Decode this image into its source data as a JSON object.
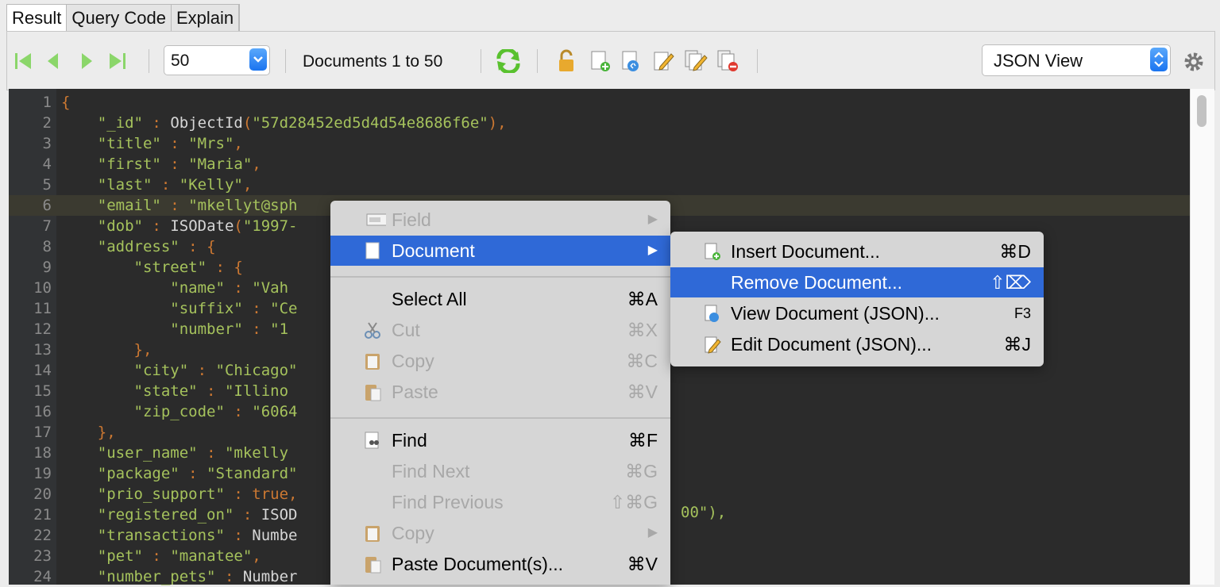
{
  "tabs": [
    "Result",
    "Query Code",
    "Explain"
  ],
  "toolbar": {
    "page_size": "50",
    "documents_text": "Documents 1 to 50",
    "view_mode": "JSON View"
  },
  "editor": {
    "lines": [
      {
        "n": "1",
        "t": "{"
      },
      {
        "n": "2",
        "t": "    \"_id\" : ObjectId(\"57d28452ed5d4d54e8686f6e\"),"
      },
      {
        "n": "3",
        "t": "    \"title\" : \"Mrs\","
      },
      {
        "n": "4",
        "t": "    \"first\" : \"Maria\","
      },
      {
        "n": "5",
        "t": "    \"last\" : \"Kelly\","
      },
      {
        "n": "6",
        "t": "    \"email\" : \"mkellyt@sph"
      },
      {
        "n": "7",
        "t": "    \"dob\" : ISODate(\"1997-"
      },
      {
        "n": "8",
        "t": "    \"address\" : {"
      },
      {
        "n": "9",
        "t": "        \"street\" : {"
      },
      {
        "n": "10",
        "t": "            \"name\" : \"Vah"
      },
      {
        "n": "11",
        "t": "            \"suffix\" : \"Ce"
      },
      {
        "n": "12",
        "t": "            \"number\" : \"1"
      },
      {
        "n": "13",
        "t": "        },"
      },
      {
        "n": "14",
        "t": "        \"city\" : \"Chicago\""
      },
      {
        "n": "15",
        "t": "        \"state\" : \"Illino"
      },
      {
        "n": "16",
        "t": "        \"zip_code\" : \"6064"
      },
      {
        "n": "17",
        "t": "    },"
      },
      {
        "n": "18",
        "t": "    \"user_name\" : \"mkelly"
      },
      {
        "n": "19",
        "t": "    \"package\" : \"Standard\""
      },
      {
        "n": "20",
        "t": "    \"prio_support\" : true,"
      },
      {
        "n": "21",
        "t": "    \"registered_on\" : ISOD"
      },
      {
        "n": "22",
        "t": "    \"transactions\" : Numbe"
      },
      {
        "n": "23",
        "t": "    \"pet\" : \"manatee\","
      },
      {
        "n": "24",
        "t": "    \"number_pets\" : Number"
      }
    ],
    "line21_tail": "00\"),"
  },
  "context_menu": {
    "items": [
      {
        "label": "Field",
        "shortcut": "▶",
        "disabled": true
      },
      {
        "label": "Document",
        "shortcut": "▶",
        "selected": true
      },
      {
        "label": "Select All",
        "shortcut": "⌘A"
      },
      {
        "label": "Cut",
        "shortcut": "⌘X",
        "disabled": true
      },
      {
        "label": "Copy",
        "shortcut": "⌘C",
        "disabled": true
      },
      {
        "label": "Paste",
        "shortcut": "⌘V",
        "disabled": true
      },
      {
        "label": "Find",
        "shortcut": "⌘F"
      },
      {
        "label": "Find Next",
        "shortcut": "⌘G",
        "disabled": true
      },
      {
        "label": "Find Previous",
        "shortcut": "⇧⌘G",
        "disabled": true
      },
      {
        "label": "Copy",
        "shortcut": "▶",
        "disabled": true
      },
      {
        "label": "Paste Document(s)...",
        "shortcut": "⌘V"
      }
    ]
  },
  "submenu": {
    "items": [
      {
        "label": "Insert Document...",
        "shortcut": "⌘D"
      },
      {
        "label": "Remove Document...",
        "shortcut": "⇧⌦",
        "selected": true
      },
      {
        "label": "View Document (JSON)...",
        "shortcut": "F3"
      },
      {
        "label": "Edit Document (JSON)...",
        "shortcut": "⌘J"
      }
    ]
  },
  "colors": {
    "accent": "#2f69d7",
    "editor_bg": "#2b2b2b",
    "key": "#a5c25c",
    "punct": "#cc7832"
  },
  "icons": [
    "first-page-icon",
    "prev-page-icon",
    "next-page-icon",
    "last-page-icon",
    "refresh-icon",
    "lock-icon",
    "insert-doc-icon",
    "view-doc-icon",
    "edit-doc-icon",
    "edit-docs-icon",
    "remove-doc-icon",
    "gear-icon"
  ]
}
